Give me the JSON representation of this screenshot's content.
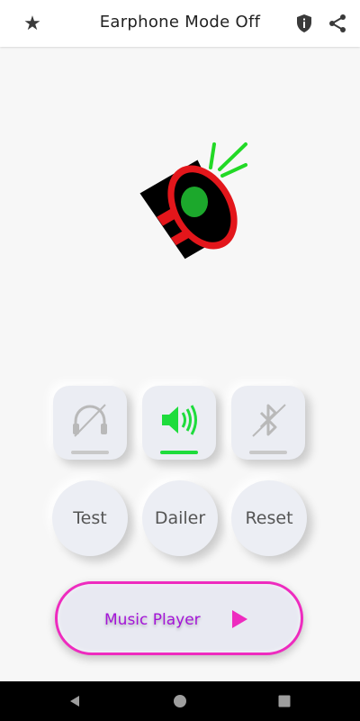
{
  "appbar": {
    "title": "Earphone Mode Off",
    "star_icon": "star-icon",
    "shield_icon": "shield-info-icon",
    "share_icon": "share-icon"
  },
  "controls": {
    "headphone": {
      "icon": "headphone-off-icon",
      "indicator_color": "#c8c8c8"
    },
    "speaker": {
      "icon": "speaker-on-icon",
      "color": "#1edc3c",
      "indicator_color": "#1edc3c"
    },
    "bluetooth": {
      "icon": "bluetooth-off-icon",
      "indicator_color": "#c8c8c8"
    }
  },
  "buttons": {
    "test": "Test",
    "dailer": "Dailer",
    "reset": "Reset"
  },
  "music": {
    "label": "Music Player",
    "accent": "#ee2bbf"
  },
  "navbar": {
    "back": "back-icon",
    "home": "home-icon",
    "recents": "recents-icon"
  }
}
